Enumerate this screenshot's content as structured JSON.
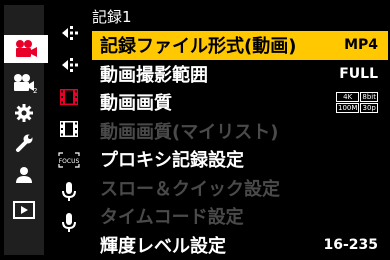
{
  "menu_title": "記録1",
  "main_tabs": [
    {
      "icon": "video-camera-icon",
      "active": true
    },
    {
      "icon": "video-camera-2-icon",
      "active": false
    },
    {
      "icon": "gear-icon",
      "active": false
    },
    {
      "icon": "wrench-icon",
      "active": false
    },
    {
      "icon": "person-icon",
      "active": false
    },
    {
      "icon": "playback-icon",
      "active": false
    }
  ],
  "sub_tabs": [
    {
      "icon": "move-arrows-icon"
    },
    {
      "icon": "move-arrows-icon"
    },
    {
      "icon": "film-icon"
    },
    {
      "icon": "film-icon"
    },
    {
      "icon": "focus-icon",
      "text": "FOCUS"
    },
    {
      "icon": "microphone-icon"
    },
    {
      "icon": "microphone-icon"
    }
  ],
  "items": [
    {
      "label": "記録ファイル形式(動画)",
      "value": "MP4",
      "selected": true,
      "disabled": false
    },
    {
      "label": "動画撮影範囲",
      "value": "FULL",
      "selected": false,
      "disabled": false
    },
    {
      "label": "動画画質",
      "value": "",
      "selected": false,
      "disabled": false
    },
    {
      "label": "動画画質(マイリスト)",
      "value": "",
      "selected": false,
      "disabled": true
    },
    {
      "label": "プロキシ記録設定",
      "value": "",
      "selected": false,
      "disabled": false
    },
    {
      "label": "スロー＆クイック設定",
      "value": "",
      "selected": false,
      "disabled": true
    },
    {
      "label": "タイムコード設定",
      "value": "",
      "selected": false,
      "disabled": true
    },
    {
      "label": "輝度レベル設定",
      "value": "16-235",
      "selected": false,
      "disabled": false
    }
  ],
  "quality_badge": {
    "res": "4K",
    "bit": "8bit",
    "rate": "100M",
    "fps": "30p"
  },
  "colors": {
    "selected_bg": "#ffc800",
    "active_tab_icon": "#e8002a",
    "disabled_text": "#4a4a4a"
  }
}
